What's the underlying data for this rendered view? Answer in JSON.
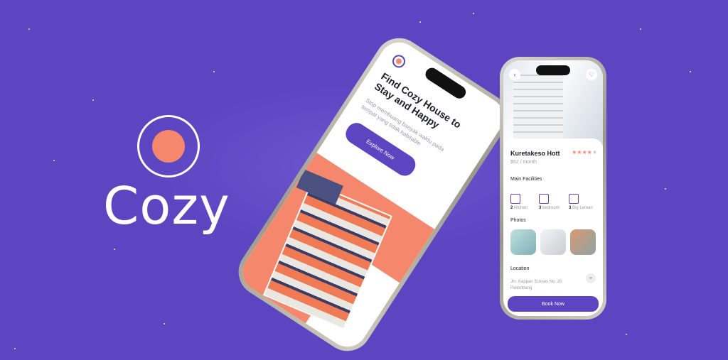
{
  "brand": {
    "name": "Cozy",
    "accent": "#F5876D",
    "primary": "#5B45C0"
  },
  "onboarding": {
    "title": "Find Cozy House to Stay and Happy",
    "subtitle": "Stop membuang banyak waktu pada tempat yang tidak habitable",
    "cta": "Explore Now"
  },
  "detail": {
    "name": "Kuretakeso Hott",
    "price": "$52 / month",
    "rating": {
      "value": 4,
      "max": 5,
      "stars_on": "★★★★",
      "stars_off": "★"
    },
    "facilities_title": "Main Facilities",
    "facilities": [
      {
        "count": "2",
        "label": "kitchen",
        "icon": "kitchen-icon"
      },
      {
        "count": "3",
        "label": "bedroom",
        "icon": "bed-icon"
      },
      {
        "count": "3",
        "label": "Big Lemari",
        "icon": "wardrobe-icon"
      }
    ],
    "photos_title": "Photos",
    "location_title": "Location",
    "address": "Jln. Kappan Sukses No. 20 Palembang",
    "book": "Book Now",
    "back_icon": "‹",
    "heart_icon": "♡",
    "pin_icon": "⌖"
  }
}
